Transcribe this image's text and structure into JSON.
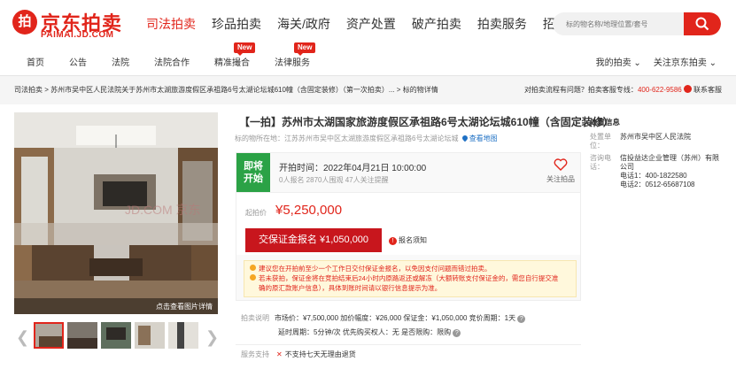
{
  "brand": {
    "logo_mark": "拍",
    "name": "京东拍卖",
    "sub": "PAIMAI.JD.COM",
    "color": "#e1251b"
  },
  "topnav": [
    {
      "label": "司法拍卖",
      "active": true
    },
    {
      "label": "珍品拍卖"
    },
    {
      "label": "海关/政府"
    },
    {
      "label": "资产处置"
    },
    {
      "label": "破产拍卖"
    },
    {
      "label": "拍卖服务"
    },
    {
      "label": "招标采购"
    }
  ],
  "search": {
    "placeholder": "标的物名称/地理位置/套号"
  },
  "subnav": {
    "left": [
      {
        "label": "首页"
      },
      {
        "label": "公告"
      },
      {
        "label": "法院"
      },
      {
        "label": "法院合作"
      },
      {
        "label": "精准撮合",
        "badge": "New"
      },
      {
        "label": "法律服务",
        "badge": "New"
      }
    ],
    "right": [
      "我的拍卖 ⌄",
      "关注京东拍卖 ⌄"
    ]
  },
  "breadcrumb": {
    "text": "司法拍卖 > 苏州市吴中区人民法院关于苏州市太湖旅游度假区承祖路6号太湖论坛城610幢（含固定装修）（第一次拍卖）... > 标的物详情",
    "help_prefix": "对拍卖流程有问题？拍卖客服专线：",
    "phone": "400-622-9586",
    "contact": "联系客服"
  },
  "photo": {
    "button": "点击查看图片详情"
  },
  "title": "【一拍】苏州市太湖国家旅游度假区承祖路6号太湖论坛城610幢（含固定装修）",
  "location": {
    "prefix": "标的物所在地：",
    "address": "江苏苏州市吴中区太湖旅游度假区承祖路6号太湖论坛城",
    "map_link": "查看地图"
  },
  "status": {
    "line1": "即将",
    "line2": "开始",
    "color": "#2ba246"
  },
  "start_time": "开拍时间：2022年04月21日 10:00:00",
  "stats": "0人报名   2870人围观   47人关注提醒",
  "follow": {
    "label": "关注拍品"
  },
  "price": {
    "label": "起拍价",
    "value": "¥5,250,000"
  },
  "deposit_button": "交保证金报名 ¥1,050,000",
  "notice": {
    "icon": "!",
    "label": "报名须知"
  },
  "warnings": [
    "建议您在开拍前至少一个工作日交付保证金报名，以免因支付问题而错过拍卖。",
    "若未获拍，保证金将在竞拍结束后24小时内原路返还或解冻（大额转账支付保证金的，需您自行提交准",
    "确的原汇款账户信息），具体到账时间请以银行信息提示为准。"
  ],
  "info": {
    "label": "拍卖说明",
    "line1": "市场价：¥7,500,000    加价幅度：¥26,000    保证金：¥1,050,000    竞价周期：1天",
    "line2": "延时周期：5分钟/次    优先购买权人：无    是否限购：限购"
  },
  "service": {
    "label": "服务支持",
    "text": "不支持七天无理由退货"
  },
  "side": {
    "title": "处置信息",
    "unit_k": "处置单位：",
    "unit_v": "苏州市吴中区人民法院",
    "contact_k": "咨询电话：",
    "contact_v1": "信投益达企业管理（苏州）有限公司",
    "contact_v2": "电话1：400-1822580",
    "contact_v3": "电话2：0512-65687108"
  }
}
